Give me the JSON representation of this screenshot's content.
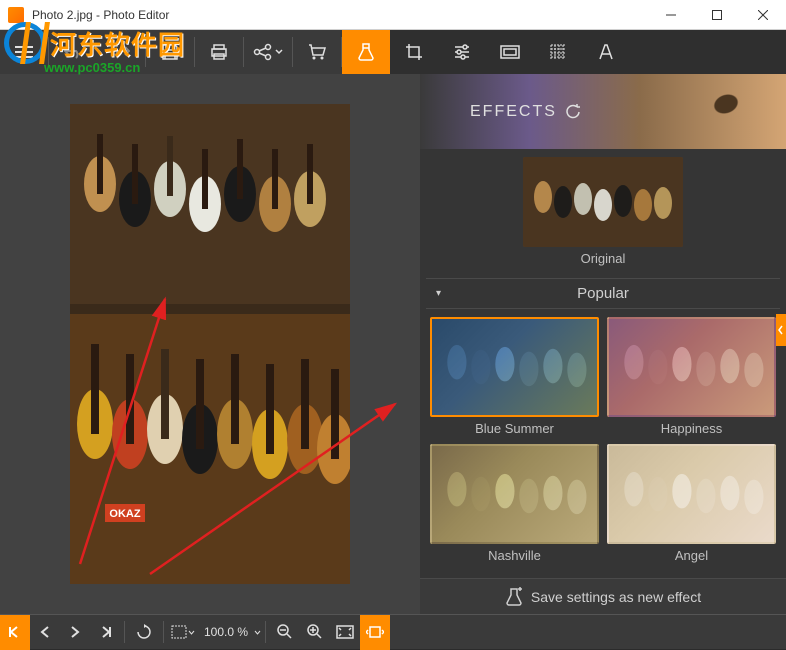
{
  "window": {
    "title": "Photo 2.jpg - Photo Editor"
  },
  "watermark": {
    "text": "河东软件园",
    "url": "www.pc0359.cn"
  },
  "effects": {
    "header_label": "EFFECTS",
    "original_label": "Original",
    "category": "Popular",
    "presets": [
      {
        "name": "Blue Summer",
        "selected": true,
        "tint": "linear-gradient(135deg,#2a4a6a,#3a5a7a 40%,#6a7a5a)"
      },
      {
        "name": "Happiness",
        "selected": false,
        "tint": "linear-gradient(135deg,#8a5a7a,#aa6a6a 40%,#ca9a7a)"
      },
      {
        "name": "Nashville",
        "selected": false,
        "tint": "linear-gradient(135deg,#7a6a4a,#9a8a5a 40%,#baa97a)"
      },
      {
        "name": "Angel",
        "selected": false,
        "tint": "linear-gradient(135deg,#caba9a,#dacaaa 40%,#eadaca)"
      }
    ],
    "save_label": "Save settings as new effect"
  },
  "bottom": {
    "zoom_value": "100.0 %"
  },
  "colors": {
    "accent": "#ff8c00"
  }
}
